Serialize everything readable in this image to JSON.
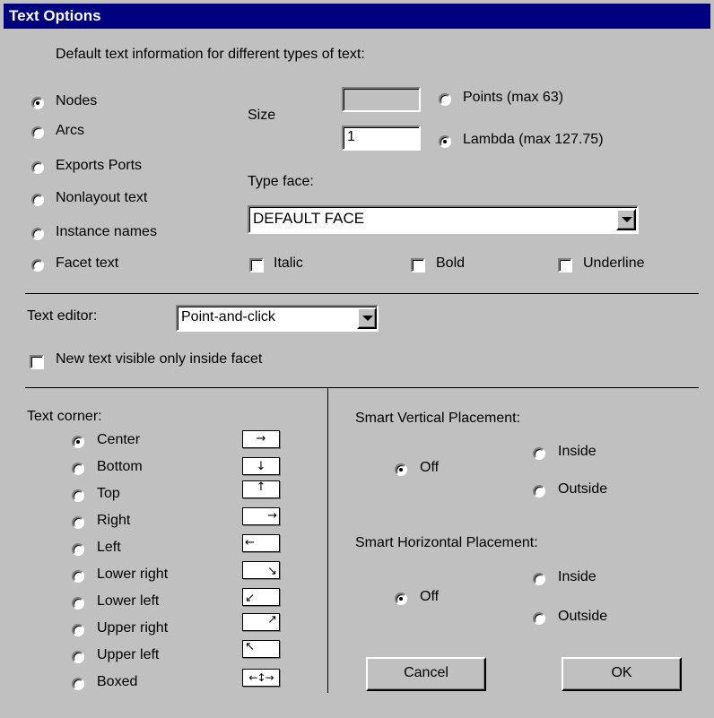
{
  "dialog": {
    "title": "Text Options"
  },
  "intro": "Default text information for different types of text:",
  "text_types": [
    {
      "label": "Nodes",
      "checked": true
    },
    {
      "label": "Arcs",
      "checked": false
    },
    {
      "label": "Exports  Ports",
      "checked": false
    },
    {
      "label": "Nonlayout text",
      "checked": false
    },
    {
      "label": "Instance names",
      "checked": false
    },
    {
      "label": "Facet text",
      "checked": false
    }
  ],
  "size": {
    "label": "Size",
    "points_value": "",
    "lambda_value": "1",
    "points_label": "Points (max 63)",
    "lambda_label": "Lambda (max 127.75)"
  },
  "typeface": {
    "label": "Type face:",
    "value": "DEFAULT FACE"
  },
  "styles": {
    "italic": "Italic",
    "bold": "Bold",
    "underline": "Underline"
  },
  "editor": {
    "label": "Text editor:",
    "value": "Point-and-click"
  },
  "visible_inside": "New text visible only inside facet",
  "corner": {
    "label": "Text corner:",
    "options": [
      {
        "label": "Center",
        "checked": true,
        "glyph": "→"
      },
      {
        "label": "Bottom",
        "checked": false,
        "glyph": "↓"
      },
      {
        "label": "Top",
        "checked": false,
        "glyph": "↑"
      },
      {
        "label": "Right",
        "checked": false,
        "glyph": "→"
      },
      {
        "label": "Left",
        "checked": false,
        "glyph": "←"
      },
      {
        "label": "Lower right",
        "checked": false,
        "glyph": "↘"
      },
      {
        "label": "Lower left",
        "checked": false,
        "glyph": "↙"
      },
      {
        "label": "Upper right",
        "checked": false,
        "glyph": "↗"
      },
      {
        "label": "Upper left",
        "checked": false,
        "glyph": "↖"
      },
      {
        "label": "Boxed",
        "checked": false,
        "glyph": "←↕→"
      }
    ]
  },
  "smart_vertical": {
    "label": "Smart Vertical Placement:",
    "off": "Off",
    "inside": "Inside",
    "outside": "Outside"
  },
  "smart_horizontal": {
    "label": "Smart Horizontal Placement:",
    "off": "Off",
    "inside": "Inside",
    "outside": "Outside"
  },
  "buttons": {
    "cancel": "Cancel",
    "ok": "OK"
  }
}
